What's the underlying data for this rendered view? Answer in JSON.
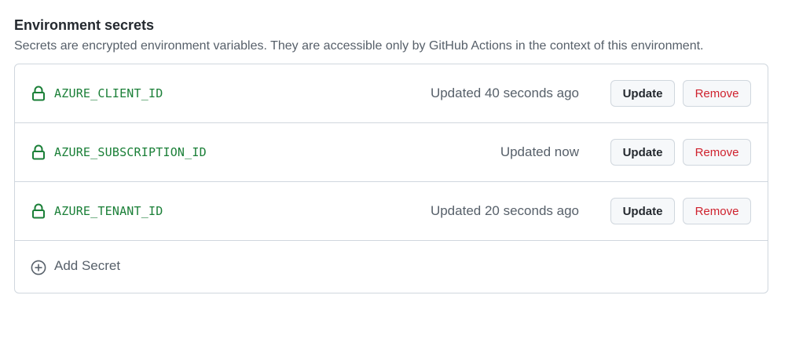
{
  "section": {
    "title": "Environment secrets",
    "description": "Secrets are encrypted environment variables. They are accessible only by GitHub Actions in the context of this environment."
  },
  "secrets": [
    {
      "name": "AZURE_CLIENT_ID",
      "updated": "Updated 40 seconds ago",
      "update_label": "Update",
      "remove_label": "Remove"
    },
    {
      "name": "AZURE_SUBSCRIPTION_ID",
      "updated": "Updated now",
      "update_label": "Update",
      "remove_label": "Remove"
    },
    {
      "name": "AZURE_TENANT_ID",
      "updated": "Updated 20 seconds ago",
      "update_label": "Update",
      "remove_label": "Remove"
    }
  ],
  "add_secret": {
    "label": "Add Secret",
    "icon": "plus-circle-icon"
  },
  "icons": {
    "secret": "lock-icon"
  },
  "colors": {
    "secret_name": "#1a7f37",
    "remove_text": "#cf222e",
    "border": "#d0d7de",
    "muted": "#57606a"
  }
}
